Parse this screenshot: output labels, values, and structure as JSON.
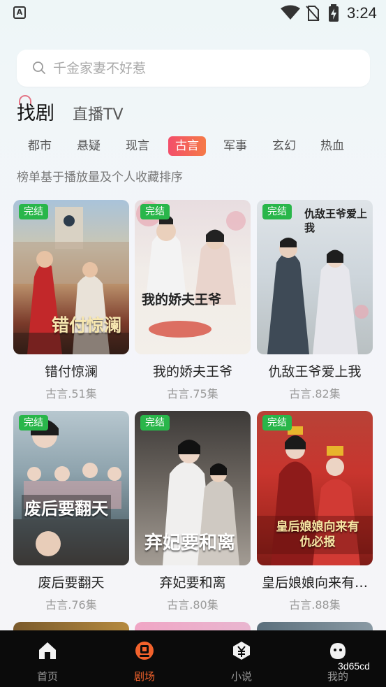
{
  "status_bar": {
    "time": "3:24",
    "app_badge": "A"
  },
  "search": {
    "placeholder": "千金家妻不好惹"
  },
  "main_tabs": [
    {
      "label": "找剧",
      "active": true
    },
    {
      "label": "直播TV",
      "active": false
    }
  ],
  "categories": [
    "都市",
    "悬疑",
    "现言",
    "古言",
    "军事",
    "玄幻",
    "热血"
  ],
  "active_category": "古言",
  "note": "榜单基于播放量及个人收藏排序",
  "dramas": [
    {
      "badge": "完结",
      "title": "错付惊澜",
      "meta": "古言.51集",
      "poster_text": "错付惊澜"
    },
    {
      "badge": "完结",
      "title": "我的娇夫王爷",
      "meta": "古言.75集",
      "poster_text": "我的娇夫王爷"
    },
    {
      "badge": "完结",
      "title": "仇敌王爷爱上我",
      "meta": "古言.82集",
      "poster_text": "仇敌王爷爱上我"
    },
    {
      "badge": "完结",
      "title": "废后要翻天",
      "meta": "古言.76集",
      "poster_text": "废后要翻天"
    },
    {
      "badge": "完结",
      "title": "弃妃要和离",
      "meta": "古言.80集",
      "poster_text": "弃妃要和离"
    },
    {
      "badge": "完结",
      "title": "皇后娘娘向来有…",
      "meta": "古言.88集",
      "poster_text": "皇后娘娘向来有仇必报"
    }
  ],
  "bottom_nav": [
    {
      "label": "首页",
      "icon": "home-icon",
      "active": false
    },
    {
      "label": "剧场",
      "icon": "theater-icon",
      "active": true
    },
    {
      "label": "小说",
      "icon": "novel-icon",
      "active": false
    },
    {
      "label": "我的",
      "icon": "profile-icon",
      "active": false
    }
  ],
  "watermark": "3d65cd",
  "colors": {
    "accent": "#f2622c",
    "badge_green": "#29b64a",
    "nav_bg": "#0b0b0b"
  }
}
